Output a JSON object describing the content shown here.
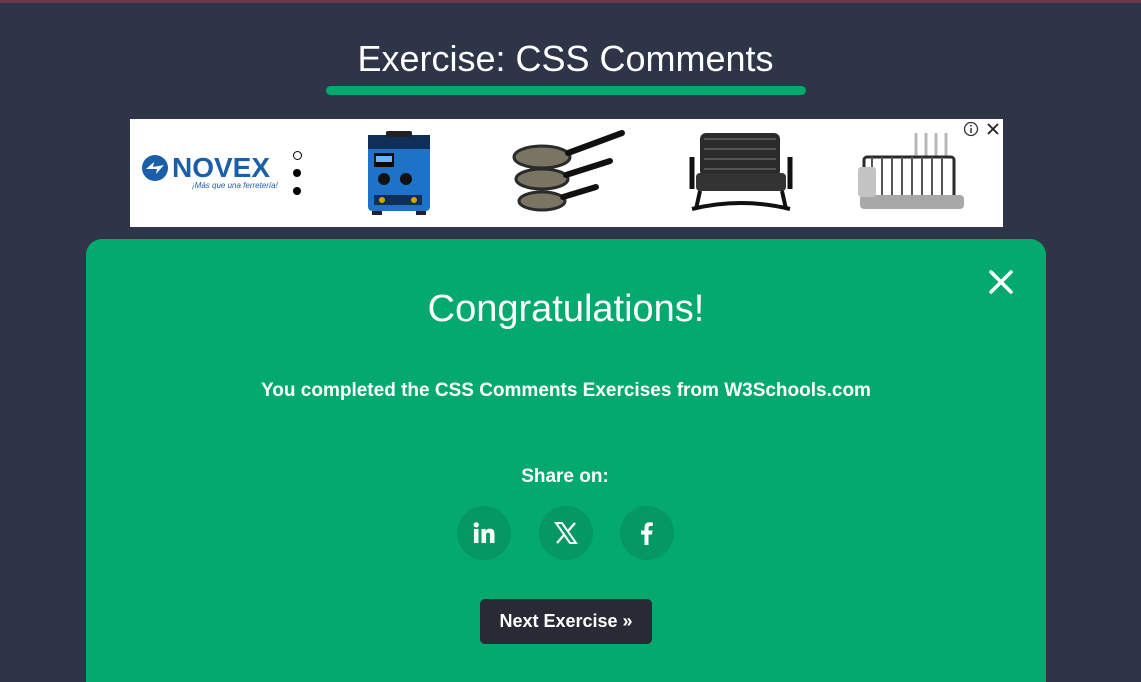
{
  "page": {
    "title": "Exercise: CSS Comments",
    "accent_color": "#04aa6d",
    "background_color": "#2f3548"
  },
  "ad": {
    "brand": "NOVEX",
    "tagline": "¡Más que una ferretería!",
    "products": [
      "welder-machine",
      "frying-pans",
      "rocking-chair",
      "dish-rack"
    ],
    "icons": [
      "info-icon",
      "close-icon"
    ]
  },
  "modal": {
    "heading": "Congratulations!",
    "message": "You completed the CSS Comments Exercises from W3Schools.com",
    "share_label": "Share on:",
    "share_buttons": [
      {
        "name": "linkedin",
        "icon": "linkedin-icon"
      },
      {
        "name": "x",
        "icon": "x-icon"
      },
      {
        "name": "facebook",
        "icon": "facebook-icon"
      }
    ],
    "next_button": "Next Exercise »",
    "close_icon": "close-icon"
  }
}
